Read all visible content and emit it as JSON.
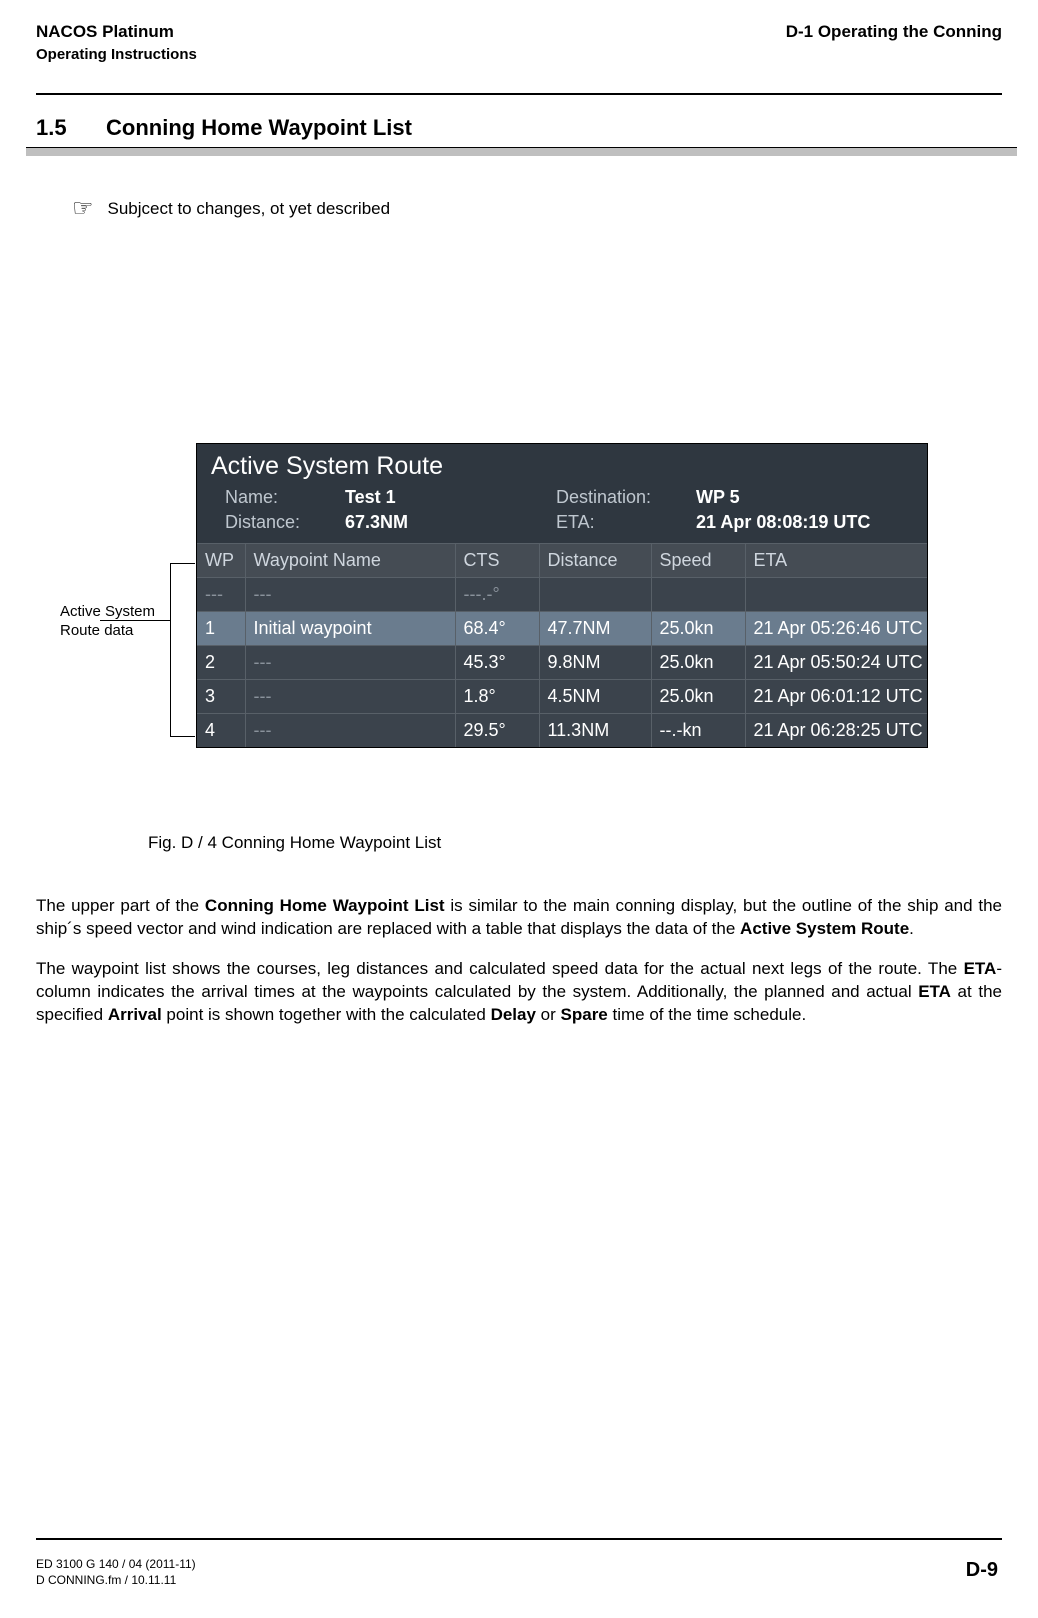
{
  "header": {
    "left_line1": "NACOS Platinum",
    "left_line2": "Operating Instructions",
    "right": "D-1  Operating the Conning"
  },
  "section": {
    "number": "1.5",
    "title": "Conning Home Waypoint List"
  },
  "note": {
    "text": "Subjcect to changes, ot yet described"
  },
  "annotation": {
    "line1": "Active System",
    "line2": "Route data"
  },
  "asr": {
    "title": "Active System Route",
    "name_label": "Name:",
    "name_value": "Test 1",
    "dest_label": "Destination:",
    "dest_value": "WP 5",
    "dist_label": "Distance:",
    "dist_value": "67.3NM",
    "eta_label": "ETA:",
    "eta_value": "21 Apr  08:08:19 UTC",
    "columns": {
      "wp": "WP",
      "name": "Waypoint Name",
      "cts": "CTS",
      "dist": "Distance",
      "spd": "Speed",
      "eta": "ETA"
    },
    "rows": [
      {
        "wp": "---",
        "name": "---",
        "cts": "---.-°",
        "dist": "",
        "spd": "",
        "eta": "",
        "sel": false,
        "dim": true
      },
      {
        "wp": "1",
        "name": "Initial waypoint",
        "cts": "68.4°",
        "dist": "47.7NM",
        "spd": "25.0kn",
        "eta": "21 Apr  05:26:46 UTC",
        "sel": true,
        "dim": false
      },
      {
        "wp": "2",
        "name": "---",
        "cts": "45.3°",
        "dist": "9.8NM",
        "spd": "25.0kn",
        "eta": "21 Apr  05:50:24 UTC",
        "sel": false,
        "dim": false
      },
      {
        "wp": "3",
        "name": "---",
        "cts": "1.8°",
        "dist": "4.5NM",
        "spd": "25.0kn",
        "eta": "21 Apr  06:01:12 UTC",
        "sel": false,
        "dim": false
      },
      {
        "wp": "4",
        "name": "---",
        "cts": "29.5°",
        "dist": "11.3NM",
        "spd": "--.-kn",
        "eta": "21 Apr  06:28:25 UTC",
        "sel": false,
        "dim": false
      }
    ]
  },
  "caption": "Fig. D /  4    Conning Home Waypoint List",
  "paragraphs": {
    "p1_a": "The upper part of the ",
    "p1_b1": "Conning Home Waypoint List",
    "p1_c": " is similar to the main conning display, but the outline of the ship and the ship´s speed vector and wind indication are replaced with a table that displays the data of the ",
    "p1_b2": "Active System Route",
    "p1_d": ".",
    "p2_a": "The waypoint list shows the courses, leg distances and calculated speed data for the actual next legs of the route. The ",
    "p2_b1": "ETA",
    "p2_c": "-column indicates the arrival times at the waypoints calculated by the system. Additionally, the planned and actual ",
    "p2_b2": "ETA",
    "p2_d": " at the specified ",
    "p2_b3": "Arrival",
    "p2_e": " point is shown together with the calculated ",
    "p2_b4": "Delay",
    "p2_f": " or ",
    "p2_b5": "Spare",
    "p2_g": " time of the time schedule."
  },
  "footer": {
    "l1": "ED 3100 G 140 / 04 (2011-11)",
    "l2": "D CONNING.fm / 10.11.11",
    "page": "D-9"
  }
}
